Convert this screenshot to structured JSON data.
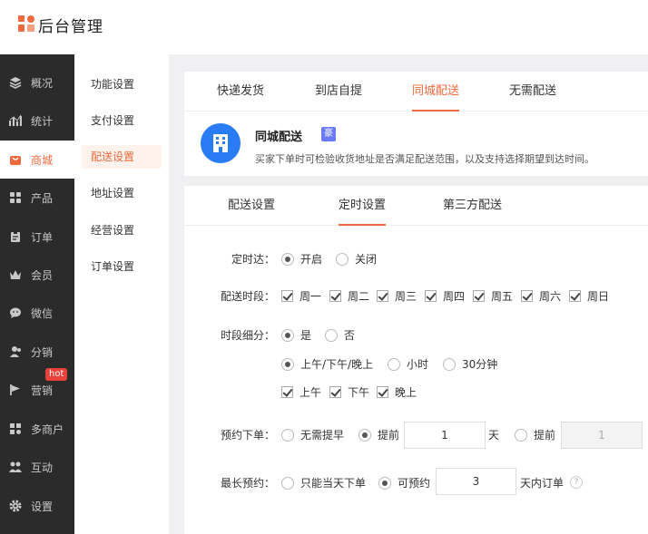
{
  "header": {
    "title": "后台管理"
  },
  "sidebar": {
    "items": [
      {
        "label": "概况",
        "icon": "layers-icon"
      },
      {
        "label": "统计",
        "icon": "chart-icon"
      },
      {
        "label": "商城",
        "icon": "shop-icon"
      },
      {
        "label": "产品",
        "icon": "grid-icon"
      },
      {
        "label": "订单",
        "icon": "clipboard-icon"
      },
      {
        "label": "会员",
        "icon": "crown-icon"
      },
      {
        "label": "微信",
        "icon": "wechat-icon"
      },
      {
        "label": "分销",
        "icon": "users-icon"
      },
      {
        "label": "营销",
        "icon": "flag-icon"
      },
      {
        "label": "多商户",
        "icon": "store-icon"
      },
      {
        "label": "互动",
        "icon": "interact-icon"
      },
      {
        "label": "设置",
        "icon": "gear-icon"
      }
    ],
    "active": "商城",
    "hot_badge": "hot"
  },
  "submenu": {
    "items": [
      {
        "label": "功能设置"
      },
      {
        "label": "支付设置"
      },
      {
        "label": "配送设置"
      },
      {
        "label": "地址设置"
      },
      {
        "label": "经营设置"
      },
      {
        "label": "订单设置"
      }
    ],
    "active": "配送设置"
  },
  "delivery_tabs": {
    "items": [
      {
        "label": "快递发货"
      },
      {
        "label": "到店自提"
      },
      {
        "label": "同城配送"
      },
      {
        "label": "无需配送"
      }
    ],
    "active": "同城配送"
  },
  "service": {
    "title": "同城配送",
    "badge": "豪",
    "description": "买家下单时可检验收货地址是否满足配送范围，以及支持选择期望到达时间。"
  },
  "config_tabs": {
    "items": [
      {
        "label": "配送设置"
      },
      {
        "label": "定时设置"
      },
      {
        "label": "第三方配送"
      }
    ],
    "active": "定时设置"
  },
  "form": {
    "timed": {
      "label": "定时达：",
      "options": [
        "开启",
        "关闭"
      ],
      "selected": "开启"
    },
    "days": {
      "label": "配送时段：",
      "options": [
        "周一",
        "周二",
        "周三",
        "周四",
        "周五",
        "周六",
        "周日"
      ],
      "checked": [
        "周一",
        "周二",
        "周三",
        "周四",
        "周五",
        "周六",
        "周日"
      ]
    },
    "split": {
      "label": "时段细分：",
      "options": [
        "是",
        "否"
      ],
      "selected": "是",
      "granularity": {
        "options": [
          "上午/下午/晚上",
          "小时",
          "30分钟"
        ],
        "selected": "上午/下午/晚上"
      },
      "periods": {
        "options": [
          "上午",
          "下午",
          "晚上"
        ],
        "checked": [
          "上午",
          "下午",
          "晚上"
        ]
      }
    },
    "advance": {
      "label": "预约下单：",
      "opt_none": "无需提早",
      "opt_days": "提前",
      "days_value": "1",
      "days_unit": "天",
      "opt_other": "提前",
      "other_value": "1",
      "selected": "提前天"
    },
    "longest": {
      "label": "最长预约：",
      "opt_today": "只能当天下单",
      "opt_can": "可预约",
      "days_value": "3",
      "suffix": "天内订单",
      "help": "?",
      "selected": "可预约"
    }
  },
  "colors": {
    "accent": "#f06a3e",
    "sidebar_bg": "#2b2b2b",
    "icon_blue": "#2a7cf5",
    "badge_purple": "#6b7bf7"
  }
}
